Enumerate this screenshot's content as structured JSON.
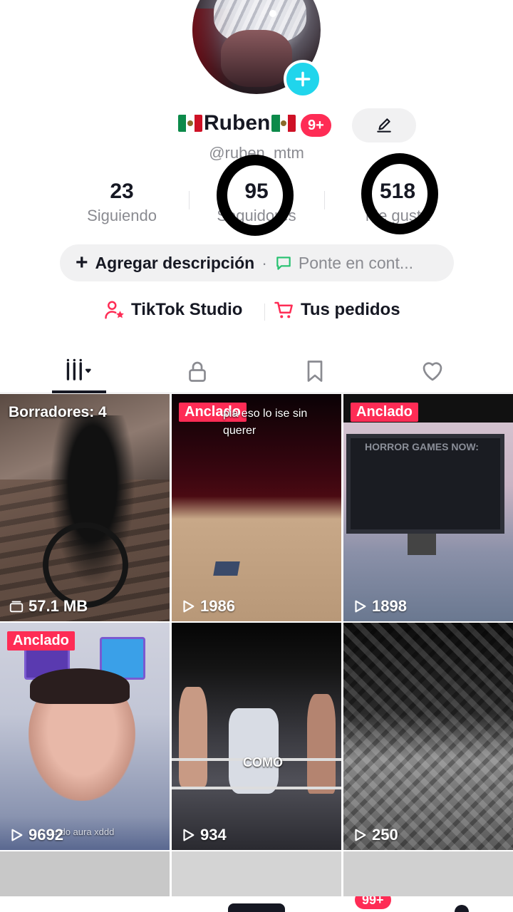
{
  "profile": {
    "name": "🇲🇽Ruben🇲🇽",
    "name_text": "Ruben",
    "notification_badge": "9+",
    "handle": "@ruben_mtm"
  },
  "stats": [
    {
      "value": "23",
      "label": "Siguiendo"
    },
    {
      "value": "95",
      "label": "Seguidores"
    },
    {
      "value": "518",
      "label": "Me gusta"
    }
  ],
  "description": {
    "add_label": "Agregar descripción",
    "separator": "·",
    "contact_label": "Ponte en cont..."
  },
  "links": {
    "studio_label": "TikTok Studio",
    "orders_label": "Tus pedidos"
  },
  "tabs": [
    {
      "icon": "grid-icon",
      "active": true
    },
    {
      "icon": "lock-icon"
    },
    {
      "icon": "bookmark-icon"
    },
    {
      "icon": "heart-icon"
    }
  ],
  "videos": [
    {
      "kind": "drafts",
      "label": "Borradores: 4",
      "size": "57.1 MB"
    },
    {
      "pinned": "Anclado",
      "caption": "pia eso lo ise sin querer",
      "views": "1986"
    },
    {
      "pinned": "Anclado",
      "screen_text": "HORROR GAMES NOW:",
      "views": "1898"
    },
    {
      "pinned": "Anclado",
      "caption": "ando aura xddd",
      "views": "9692"
    },
    {
      "caption": "COMO",
      "views": "934"
    },
    {
      "views": "250"
    }
  ],
  "bottom_nav": {
    "inbox_badge": "99+"
  },
  "colors": {
    "accent": "#fe2c55",
    "cyan": "#20d5ec",
    "text": "#161823",
    "muted": "#8a8b91"
  }
}
